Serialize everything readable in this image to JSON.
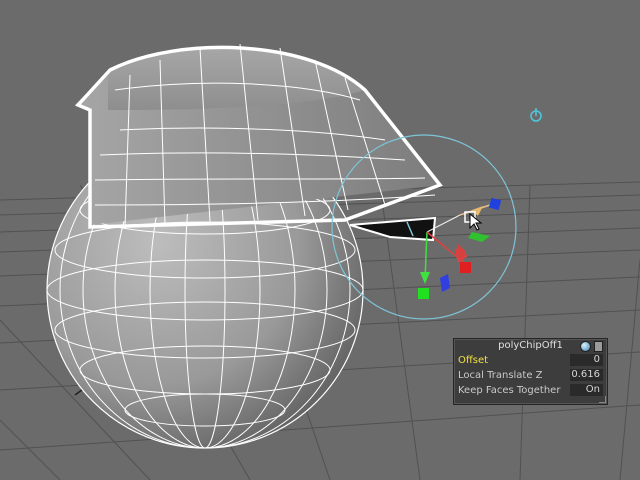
{
  "viewport": {
    "background": "#6b6b6b",
    "wire_color": "#ffffff",
    "selection_color": "#ffffff",
    "manip_color": "#7ec4d8"
  },
  "icons": {
    "pivot_icon": "power-like pivot icon",
    "rotate_ring": "tool ring",
    "cursor": "mouse-pointer-icon"
  },
  "channel_box": {
    "title": "polyChipOff1",
    "rows": [
      {
        "label": "Offset",
        "value": "0",
        "highlight": true
      },
      {
        "label": "Local Translate Z",
        "value": "0.616",
        "highlight": false
      },
      {
        "label": "Keep Faces Together",
        "value": "On",
        "highlight": false
      }
    ]
  }
}
